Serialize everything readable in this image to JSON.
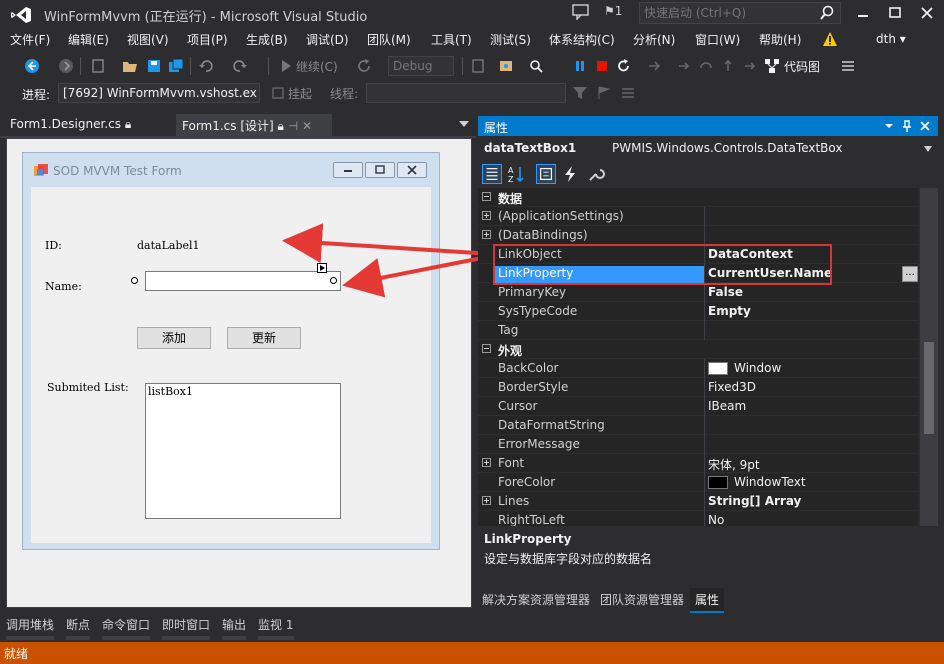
{
  "window": {
    "title": "WinFormMvvm (正在运行) - Microsoft Visual Studio",
    "flag_count": "1",
    "quick_launch_placeholder": "快速启动 (Ctrl+Q)",
    "user": "dth"
  },
  "menu": [
    "文件(F)",
    "编辑(E)",
    "视图(V)",
    "项目(P)",
    "生成(B)",
    "调试(D)",
    "团队(M)",
    "工具(T)",
    "测试(S)",
    "体系结构(C)",
    "分析(N)",
    "窗口(W)",
    "帮助(H)"
  ],
  "toolbar": {
    "continue_label": "继续(C)",
    "config": "Debug",
    "code_map_label": "代码图"
  },
  "debug_bar": {
    "process_label": "进程:",
    "process_value": "[7692] WinFormMvvm.vshost.ex",
    "suspend_label": "挂起",
    "thread_label": "线程:"
  },
  "doc_tabs": [
    {
      "label": "Form1.Designer.cs"
    },
    {
      "label": "Form1.cs [设计]"
    }
  ],
  "form": {
    "title": "SOD MVVM Test Form",
    "id_label": "ID:",
    "id_value": "dataLabel1",
    "name_label": "Name:",
    "name_value": "",
    "add_button": "添加",
    "update_button": "更新",
    "list_label": "Submited List:",
    "list_item": "listBox1"
  },
  "properties": {
    "header": "属性",
    "object_name": "dataTextBox1",
    "object_type": "PWMIS.Windows.Controls.DataTextBox",
    "categories": {
      "data": "数据",
      "appearance": "外观"
    },
    "rows": [
      {
        "name": "(ApplicationSettings)",
        "value": ""
      },
      {
        "name": "(DataBindings)",
        "value": ""
      },
      {
        "name": "LinkObject",
        "value": "DataContext"
      },
      {
        "name": "LinkProperty",
        "value": "CurrentUser.Name"
      },
      {
        "name": "PrimaryKey",
        "value": "False"
      },
      {
        "name": "SysTypeCode",
        "value": "Empty"
      },
      {
        "name": "Tag",
        "value": ""
      },
      {
        "name": "BackColor",
        "value": "Window"
      },
      {
        "name": "BorderStyle",
        "value": "Fixed3D"
      },
      {
        "name": "Cursor",
        "value": "IBeam"
      },
      {
        "name": "DataFormatString",
        "value": ""
      },
      {
        "name": "ErrorMessage",
        "value": ""
      },
      {
        "name": "Font",
        "value": "宋体, 9pt"
      },
      {
        "name": "ForeColor",
        "value": "WindowText"
      },
      {
        "name": "Lines",
        "value": "String[] Array"
      },
      {
        "name": "RightToLeft",
        "value": "No"
      }
    ],
    "ellipsis": "...",
    "description_name": "LinkProperty",
    "description_text": "设定与数据库字段对应的数据名",
    "tabs": [
      "解决方案资源管理器",
      "团队资源管理器",
      "属性"
    ]
  },
  "bottom_tabs": [
    "调用堆栈",
    "断点",
    "命令窗口",
    "即时窗口",
    "输出",
    "监视 1"
  ],
  "status": "就绪",
  "colors": {
    "accent": "#007acc",
    "status_bar": "#ca5100",
    "highlight": "#dd3333"
  }
}
